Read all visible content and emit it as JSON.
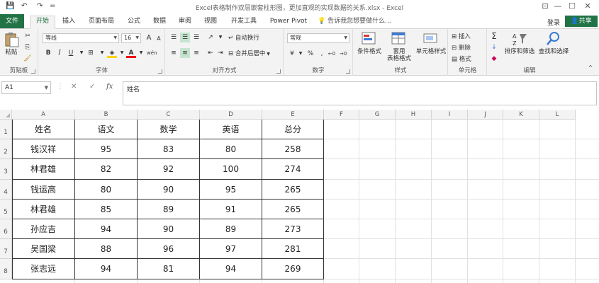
{
  "titlebar": {
    "title": "Excel表格制作双层嵌套柱形图，更加直观的实现数据的关系.xlsx - Excel",
    "save_icon": "💾",
    "undo_icon": "↶",
    "redo_icon": "↷",
    "qat_more": "=",
    "min": "—",
    "restore": "☐",
    "close": "✕",
    "ribbon_opt": "⊡"
  },
  "tabs": {
    "file": "文件",
    "items": [
      "开始",
      "插入",
      "页面布局",
      "公式",
      "数据",
      "审阅",
      "视图",
      "开发工具",
      "Power Pivot"
    ],
    "tellme": "告诉我您想要做什么...",
    "login": "登录",
    "share": "共享"
  },
  "ribbon": {
    "clipboard": {
      "label": "剪贴板",
      "paste": "粘贴"
    },
    "font": {
      "label": "字体",
      "name": "等线",
      "size": "16",
      "bold": "B",
      "italic": "I",
      "underline": "U",
      "grow": "A",
      "shrink": "A",
      "phonetic": "wén"
    },
    "alignment": {
      "label": "对齐方式",
      "wrap": "自动换行",
      "merge": "合并后居中"
    },
    "number": {
      "label": "数字",
      "format": "常规"
    },
    "styles": {
      "label": "样式",
      "cond": "条件格式",
      "table_line1": "套用",
      "table_line2": "表格格式",
      "cell": "单元格样式"
    },
    "cells": {
      "label": "单元格",
      "insert": "插入",
      "delete": "删除",
      "format": "格式"
    },
    "editing": {
      "label": "编辑",
      "sort": "排序和筛选",
      "find": "查找和选择"
    }
  },
  "formulabar": {
    "namebox": "A1",
    "cancel": "✕",
    "enter": "✓",
    "fx": "fx",
    "content": "姓名"
  },
  "sheet": {
    "columns": [
      "A",
      "B",
      "C",
      "D",
      "E",
      "F",
      "G",
      "H",
      "I",
      "J",
      "K",
      "L"
    ],
    "rows": [
      "1",
      "2",
      "3",
      "4",
      "5",
      "6",
      "7",
      "8"
    ],
    "table": [
      [
        "姓名",
        "语文",
        "数学",
        "英语",
        "总分"
      ],
      [
        "钱汉祥",
        "95",
        "83",
        "80",
        "258"
      ],
      [
        "林君雄",
        "82",
        "92",
        "100",
        "274"
      ],
      [
        "钱运高",
        "80",
        "90",
        "95",
        "265"
      ],
      [
        "林君雄",
        "85",
        "89",
        "91",
        "265"
      ],
      [
        "孙应吉",
        "94",
        "90",
        "89",
        "273"
      ],
      [
        "吴国梁",
        "88",
        "96",
        "97",
        "281"
      ],
      [
        "张志远",
        "94",
        "81",
        "94",
        "269"
      ]
    ]
  },
  "colors": {
    "accent": "#217346",
    "ribbon_bg": "#f3f3f3",
    "border": "#333333"
  }
}
